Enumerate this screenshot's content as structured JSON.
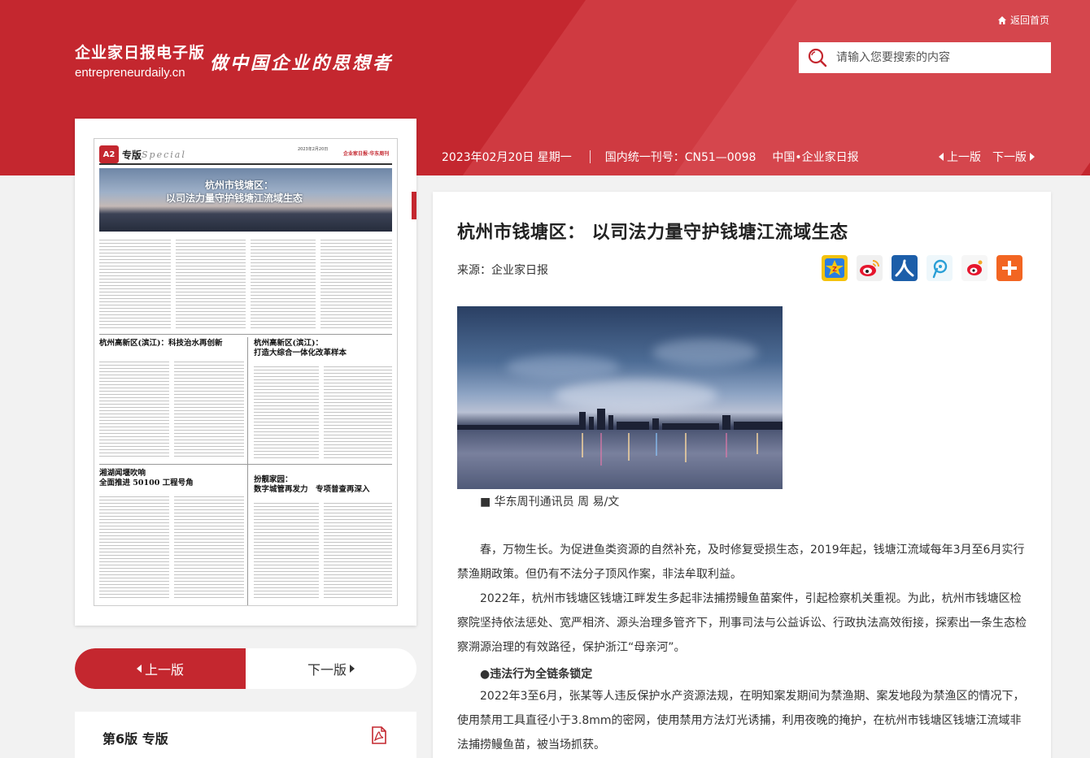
{
  "site": {
    "name_cn": "企业家日报电子版",
    "name_en": "entrepreneurdaily.cn",
    "slogan": "做中国企业的思想者",
    "home_link": "返回首页",
    "search_placeholder": "请输入您要搜索的内容"
  },
  "colors": {
    "brand_red": "#c4272f",
    "background": "#f2f2f2"
  },
  "thumbnail": {
    "badge": "A2",
    "section": "专版",
    "section_en": "Special",
    "date_line": "2023年2月20日",
    "brand": "企业家日报·华东周刊",
    "banner_title_1": "杭州市钱塘区：",
    "banner_title_2": "以司法力量守护钱塘江流域生态",
    "headlines": [
      "杭州高新区(滨江)：科技治水再创新",
      "杭州高新区(滨江)：",
      "打造大综合一体化改革样本",
      "湘湖闻堰吹响",
      "全面推进 50100 工程号角",
      "扮靓家园：",
      "数字城管再发力　专项普查再深入"
    ]
  },
  "pager": {
    "prev": "上一版",
    "next": "下一版"
  },
  "edition": {
    "label": "第6版 专版",
    "pdf_icon": "pdf-icon"
  },
  "infobar": {
    "date": "2023年02月20日 星期一",
    "issn": "国内统一刊号：CN51—0098",
    "paper": "中国•企业家日报",
    "prev": "上一版",
    "next": "下一版"
  },
  "article": {
    "title": "杭州市钱塘区： 以司法力量守护钱塘江流域生态",
    "source": "来源：企业家日报",
    "share_icons": [
      "qzone-icon",
      "weibo-icon",
      "renren-icon",
      "tencent-weibo-icon",
      "sina-icon",
      "more-share-icon"
    ],
    "caption": "■ 华东周刊通讯员 周 易/文",
    "paragraphs": [
      "春，万物生长。为促进鱼类资源的自然补充，及时修复受损生态，2019年起，钱塘江流域每年3月至6月实行禁渔期政策。但仍有不法分子顶风作案，非法牟取利益。",
      "2022年，杭州市钱塘区钱塘江畔发生多起非法捕捞鳗鱼苗案件，引起检察机关重视。为此，杭州市钱塘区检察院坚持依法惩处、宽严相济、源头治理多管齐下，刑事司法与公益诉讼、行政执法高效衔接，探索出一条生态检察溯源治理的有效路径，保护浙江“母亲河”。",
      "2022年3至6月，张某等人违反保护水产资源法规，在明知案发期间为禁渔期、案发地段为禁渔区的情况下，使用禁用工具直径小于3.8mm的密网，使用禁用方法灯光诱捕，利用夜晚的掩护，在杭州市钱塘区钱塘江流域非法捕捞鳗鱼苗，被当场抓获。"
    ],
    "subheading": "●违法行为全链条锁定"
  }
}
